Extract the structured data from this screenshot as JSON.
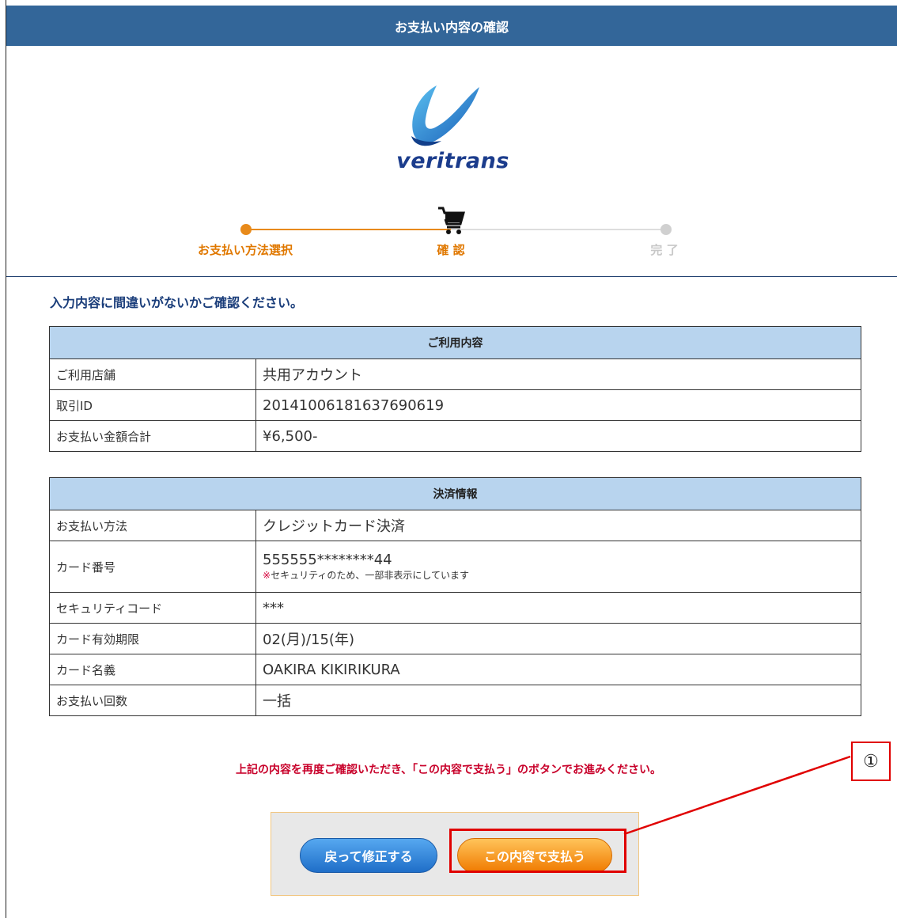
{
  "header": {
    "title": "お支払い内容の確認"
  },
  "logo": {
    "text": "veritrans"
  },
  "steps": [
    {
      "label": "お支払い方法選択",
      "state": "done"
    },
    {
      "label": "確 認",
      "state": "current"
    },
    {
      "label": "完 了",
      "state": "pending"
    }
  ],
  "intro": "入力内容に間違いがないかご確認ください。",
  "usage_table": {
    "heading": "ご利用内容",
    "rows": [
      {
        "label": "ご利用店舗",
        "value": "共用アカウント"
      },
      {
        "label": "取引ID",
        "value": "20141006181637690619"
      },
      {
        "label": "お支払い金額合計",
        "value": "¥6,500-"
      }
    ]
  },
  "payment_table": {
    "heading": "決済情報",
    "rows": [
      {
        "label": "お支払い方法",
        "value": "クレジットカード決済"
      },
      {
        "label": "カード番号",
        "value": "555555********44",
        "note_mark": "※",
        "note": "セキュリティのため、一部非表示にしています"
      },
      {
        "label": "セキュリティコード",
        "value": "***"
      },
      {
        "label": "カード有効期限",
        "value": "02(月)/15(年)"
      },
      {
        "label": "カード名義",
        "value": "OAKIRA KIKIRIKURA"
      },
      {
        "label": "お支払い回数",
        "value": "一括"
      }
    ]
  },
  "confirm_message": "上記の内容を再度ご確認いただき、「この内容で支払う」のボタンでお進みください。",
  "buttons": {
    "back": "戻って修正する",
    "pay": "この内容で支払う"
  },
  "annotation": {
    "label": "①"
  },
  "colors": {
    "header": "#336699",
    "accent_orange": "#f07a00",
    "step_done": "#e88a1a",
    "step_label_current": "#e07800",
    "step_pending": "#cccccc",
    "table_header": "#b8d4ee",
    "message_red": "#c8002a",
    "annotation_red": "#e00000"
  }
}
